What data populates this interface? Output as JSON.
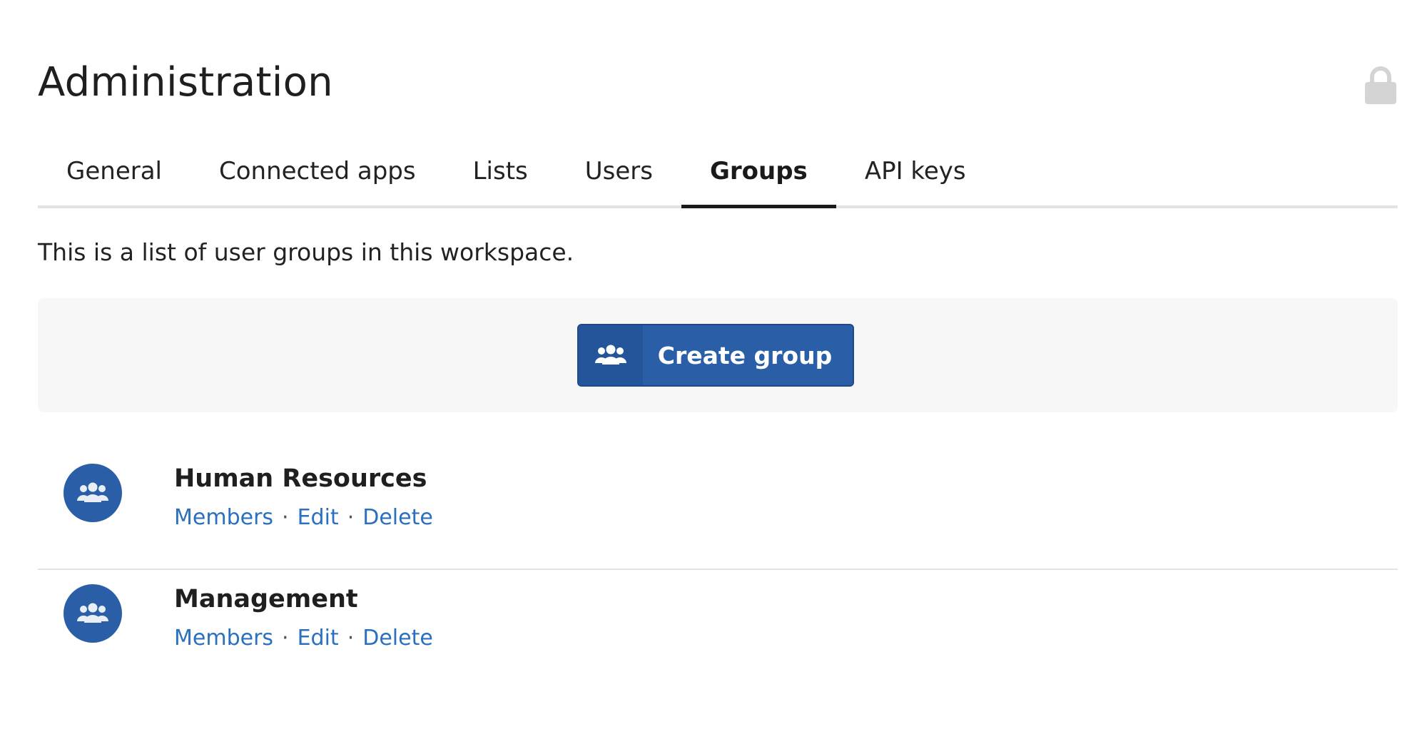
{
  "page": {
    "title": "Administration",
    "lock_icon": "lock-icon"
  },
  "tabs": [
    {
      "label": "General",
      "active": false
    },
    {
      "label": "Connected apps",
      "active": false
    },
    {
      "label": "Lists",
      "active": false
    },
    {
      "label": "Users",
      "active": false
    },
    {
      "label": "Groups",
      "active": true
    },
    {
      "label": "API keys",
      "active": false
    }
  ],
  "description": "This is a list of user groups in this workspace.",
  "create_button": {
    "label": "Create group",
    "icon": "users-icon"
  },
  "groups": [
    {
      "name": "Human Resources",
      "icon": "users-icon",
      "actions": {
        "members": "Members",
        "edit": "Edit",
        "delete": "Delete"
      }
    },
    {
      "name": "Management",
      "icon": "users-icon",
      "actions": {
        "members": "Members",
        "edit": "Edit",
        "delete": "Delete"
      }
    }
  ],
  "colors": {
    "accent": "#2a5fa8",
    "link": "#2a6fc0",
    "panel": "#f7f7f7",
    "divider": "#e3e3e3",
    "lock": "#d4d4d4"
  }
}
